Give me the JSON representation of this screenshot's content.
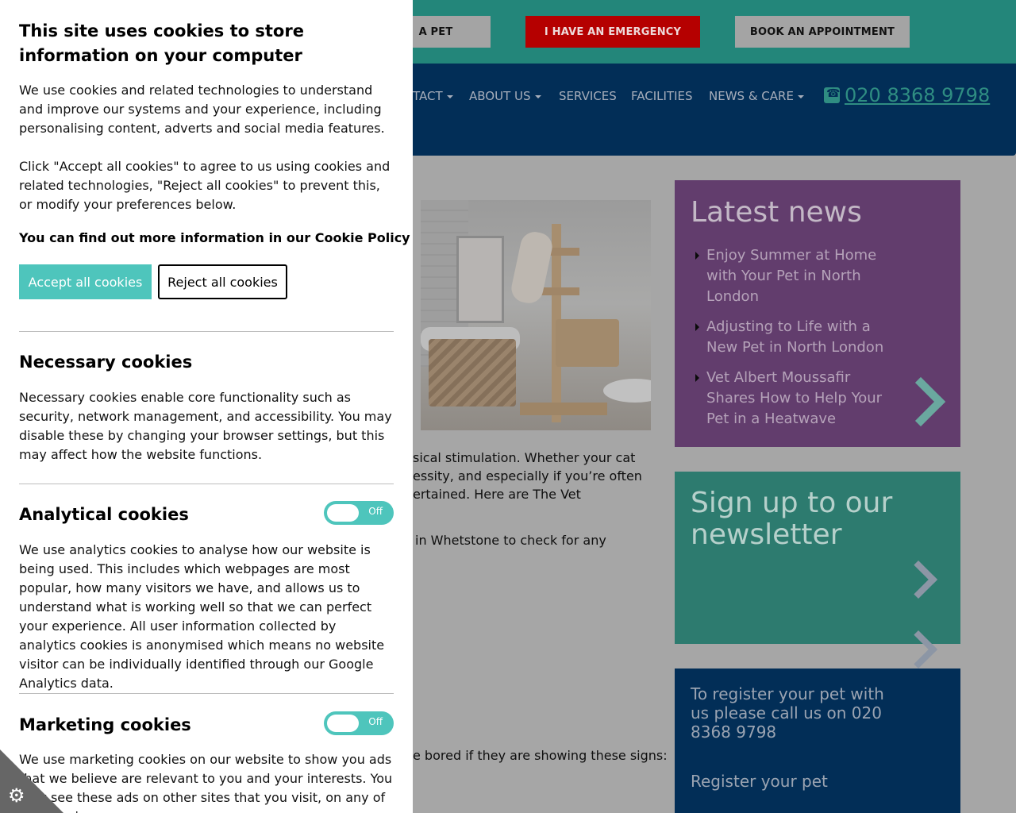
{
  "topbar": {
    "register_label": "A PET",
    "emergency_label": "I HAVE AN EMERGENCY",
    "book_label": "BOOK AN APPOINTMENT"
  },
  "nav": {
    "contact": "TACT",
    "about": "ABOUT US",
    "services": "SERVICES",
    "facilities": "FACILITIES",
    "news": "NEWS & CARE",
    "phone": "020 8368 9798"
  },
  "article": {
    "line1": "sical stimulation. Whether your cat",
    "line2": "essity, and especially if you’re often",
    "line3": "ertained. Here are The Vet",
    "line4": "in Whetstone to check for any",
    "line5": "e bored if they are showing these signs:"
  },
  "news": {
    "title": "Latest news",
    "items": [
      "Enjoy Summer at Home with Your Pet in North London",
      "Adjusting to Life with a New Pet in North London",
      "Vet Albert Moussafir Shares How to Help Your Pet in a Heatwave"
    ]
  },
  "newsletter": {
    "title": "Sign up to our newsletter"
  },
  "register": {
    "text": "To register your pet with us please call us on 020 8368 9798",
    "link": "Register your pet"
  },
  "cookie": {
    "title": "This site uses cookies to store information on your computer",
    "intro": "We use cookies and related technologies to understand and improve our systems and your experience, including personalising content, adverts and social media features.",
    "click_info": "Click \"Accept all cookies\" to agree to us using cookies and related technologies, \"Reject all cookies\" to prevent this, or modify your preferences below.",
    "more_info": "You can find out more information in our Cookie Policy",
    "accept_label": "Accept all cookies",
    "reject_label": "Reject all cookies",
    "necessary": {
      "title": "Necessary cookies",
      "text": "Necessary cookies enable core functionality such as security, network management, and accessibility. You may disable these by changing your browser settings, but this may affect how the website functions."
    },
    "analytical": {
      "title": "Analytical cookies",
      "toggle": "Off",
      "text": "We use analytics cookies to analyse how our website is being used. This includes which webpages are most popular, how many visitors we have, and allows us to understand what is working well so that we can perfect your experience. All user information collected by analytics cookies is anonymised which means no website visitor can be individually identified through our Google Analytics data."
    },
    "marketing": {
      "title": "Marketing cookies",
      "toggle": "Off",
      "text": "We use marketing cookies on our website to show you ads that we believe are relevant to you and your interests. You may see these ads on other sites that you visit, on any of your devices"
    }
  },
  "colors": {
    "accent": "#4ec5bc",
    "nav_bg": "#022e57",
    "emergency": "#b50000",
    "news_bg": "#623d6d"
  },
  "icons": {
    "phone": "phone-icon",
    "external": "external-link-icon",
    "gear": "gear-icon"
  }
}
